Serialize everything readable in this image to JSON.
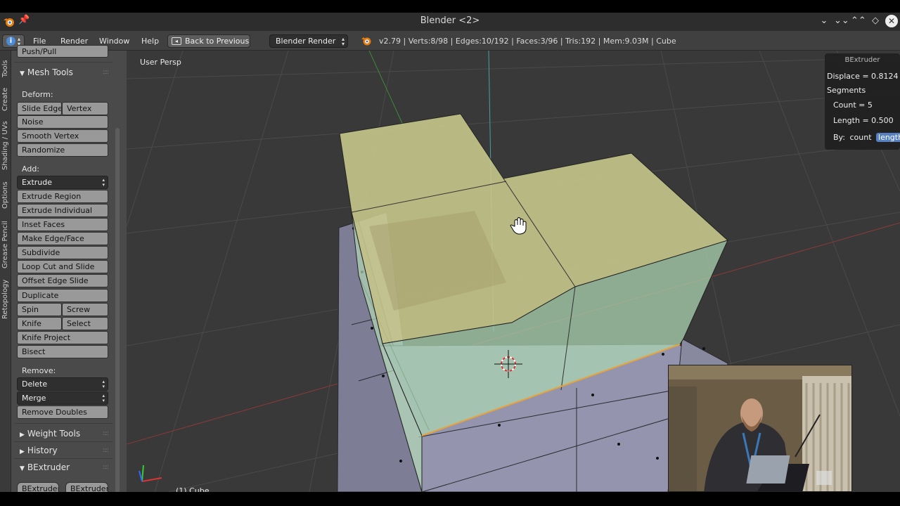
{
  "window": {
    "title": "Blender <2>",
    "controls": [
      "⌄",
      "⌄⌄",
      "⌃⌃",
      "◇",
      "✕"
    ]
  },
  "infobar": {
    "menus": [
      "File",
      "Render",
      "Window",
      "Help"
    ],
    "back_button": "Back to Previous",
    "render_engine": "Blender Render",
    "stats": "v2.79 | Verts:8/98 | Edges:10/192 | Faces:3/96 | Tris:192 | Mem:9.03M | Cube"
  },
  "tabs": [
    "Tools",
    "Create",
    "Shading / UVs",
    "Options",
    "Grease Pencil",
    "Retopology"
  ],
  "shelf": {
    "top_cut_button": "Push/Pull",
    "mesh_tools": {
      "title": "Mesh Tools",
      "deform_label": "Deform:",
      "deform": {
        "slide_edge": "Slide Edge",
        "vertex": "Vertex",
        "noise": "Noise",
        "smooth_vertex": "Smooth Vertex",
        "randomize": "Randomize"
      },
      "add_label": "Add:",
      "add": {
        "extrude": "Extrude",
        "extrude_region": "Extrude Region",
        "extrude_individual": "Extrude Individual",
        "inset_faces": "Inset Faces",
        "make_edge_face": "Make Edge/Face",
        "subdivide": "Subdivide",
        "loop_cut": "Loop Cut and Slide",
        "offset_edge_slide": "Offset Edge Slide",
        "duplicate": "Duplicate",
        "spin": "Spin",
        "screw": "Screw",
        "knife": "Knife",
        "select": "Select",
        "knife_project": "Knife Project",
        "bisect": "Bisect"
      },
      "remove_label": "Remove:",
      "remove": {
        "delete": "Delete",
        "merge": "Merge",
        "remove_doubles": "Remove Doubles"
      }
    },
    "panels": {
      "weight_tools": "Weight Tools",
      "history": "History",
      "bextruder": "BExtruder"
    },
    "bextruder_buttons": [
      "BExtruder",
      "BExtruder"
    ]
  },
  "viewport": {
    "label": "User Persp",
    "object_label": "(1) Cube"
  },
  "redo_panel": {
    "title": "BExtruder",
    "displace": "Displace = 0.8124",
    "segments_label": "Segments",
    "count": "Count = 5",
    "length": "Length = 0.500",
    "by_label": "By:",
    "by_options": [
      "count",
      "length"
    ],
    "by_selected": "length"
  },
  "colors": {
    "accent": "#5680c2",
    "selection_orange": "#e8a23a",
    "mesh_face": "#8f8fa8",
    "extrude_face": "#c8c890"
  }
}
